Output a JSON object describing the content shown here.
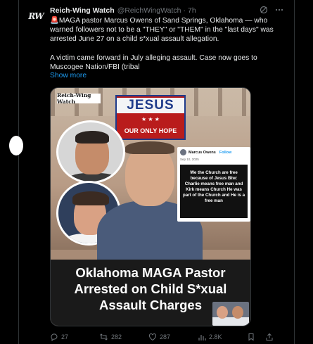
{
  "account": {
    "avatar_text": "RW",
    "display_name": "Reich-Wing Watch",
    "handle": "@ReichWingWatch",
    "separator": "·",
    "time": "7h"
  },
  "tweet": {
    "paragraph1": "🚨MAGA pastor Marcus Owens of Sand Springs, Oklahoma — who warned followers not to be a \"THEY\" or \"THEM\" in the \"last days\" was arrested June 27 on a child s*xual assault allegation.",
    "paragraph2": "A victim came forward in July alleging assault. Case now goes to Muscogee Nation/FBI (tribal",
    "show_more": "Show more"
  },
  "media": {
    "brand_tag": "Reich-Wing Watch",
    "banner_main": "JESUS",
    "banner_bottom": "OUR ONLY HOPE",
    "card_author": "Marcus Owens",
    "card_follow": "Follow",
    "card_date": "Sep 10, 2025",
    "card_text": "We the Church are free because of Jesus Btw: Charlie means free man and Kirk means Church He was part of the Church and He is a free man",
    "headline": "Oklahoma MAGA Pastor Arrested on Child S*xual Assault Charges"
  },
  "actions": {
    "replies": "27",
    "reposts": "282",
    "likes": "287",
    "views": "2.8K"
  },
  "icons": [
    "grok-icon",
    "more-icon",
    "reply-icon",
    "repost-icon",
    "like-icon",
    "views-icon",
    "bookmark-icon",
    "share-icon"
  ],
  "colors": {
    "background": "#000000",
    "text": "#e7e9ea",
    "muted": "#71767b",
    "link": "#1d9bf0"
  }
}
